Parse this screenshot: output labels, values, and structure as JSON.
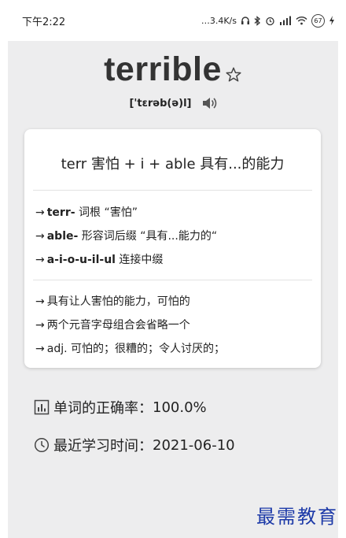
{
  "status_bar": {
    "time": "下午2:22",
    "network_speed": "…3.4K/s",
    "icons": [
      "headphones-icon",
      "bluetooth-icon",
      "alarm-icon",
      "signal-icon",
      "wifi-icon"
    ],
    "battery": "67",
    "charging_icon": "lightning-icon"
  },
  "word": {
    "text": "terrible",
    "favorite_icon": "star-outline-icon",
    "phonetic": "['tɛrəb(ə)l]",
    "audio_icon": "speaker-icon"
  },
  "card": {
    "title": "terr 害怕 + i + able 具有...的能力",
    "roots": [
      {
        "arrow": "→",
        "term": "terr-",
        "desc": " 词根 “害怕”"
      },
      {
        "arrow": "→",
        "term": "able-",
        "desc": " 形容词后缀 “具有...能力的“"
      },
      {
        "arrow": "→",
        "term": "a-i-o-u-il-ul",
        "desc": " 连接中缀"
      }
    ],
    "meanings": [
      {
        "arrow": "→",
        "text": "具有让人害怕的能力，可怕的"
      },
      {
        "arrow": "→",
        "text": "两个元音字母组合会省略一个"
      },
      {
        "arrow": "→",
        "text": "adj. 可怕的；很糟的；令人讨厌的；"
      }
    ]
  },
  "stats": {
    "accuracy_label": "单词的正确率：",
    "accuracy_value": "100.0%",
    "last_study_label": "最近学习时间：",
    "last_study_value": "2021-06-10"
  },
  "watermark": "最需教育",
  "colors": {
    "background": "#ededee",
    "card": "#ffffff",
    "watermark": "#1d3aa8"
  }
}
